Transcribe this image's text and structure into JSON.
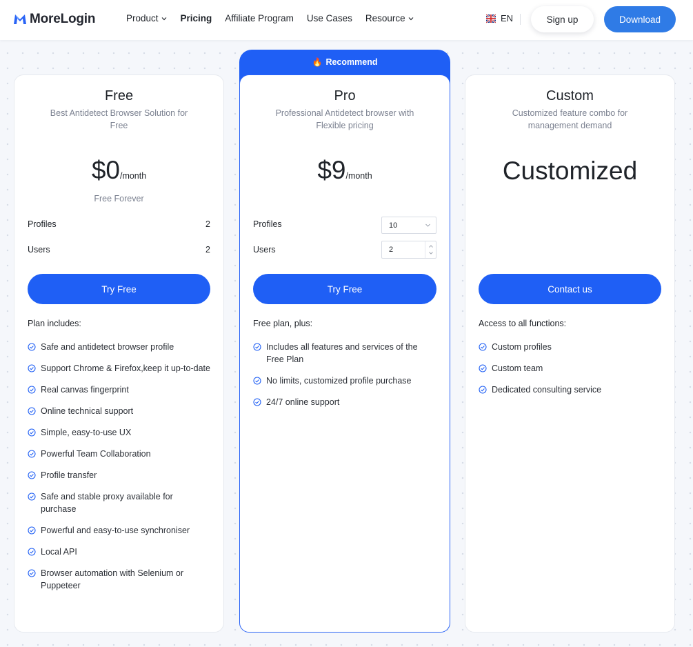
{
  "header": {
    "logo_text": "MoreLogin",
    "nav": [
      {
        "label": "Product",
        "has_dropdown": true,
        "active": false
      },
      {
        "label": "Pricing",
        "has_dropdown": false,
        "active": true
      },
      {
        "label": "Affiliate Program",
        "has_dropdown": false,
        "active": false
      },
      {
        "label": "Use Cases",
        "has_dropdown": false,
        "active": false
      },
      {
        "label": "Resource",
        "has_dropdown": true,
        "active": false
      }
    ],
    "language": "EN",
    "signup_label": "Sign up",
    "download_label": "Download"
  },
  "recommend_badge": "Recommend",
  "plans": {
    "free": {
      "name": "Free",
      "description": "Best Antidetect Browser Solution for Free",
      "price_amount": "$0",
      "price_period": "/month",
      "subnote": "Free Forever",
      "profiles_label": "Profiles",
      "profiles_value": "2",
      "users_label": "Users",
      "users_value": "2",
      "cta_label": "Try Free",
      "includes_title": "Plan includes:",
      "features": [
        "Safe and antidetect browser profile",
        "Support Chrome & Firefox,keep it up-to-date",
        "Real canvas fingerprint",
        "Online technical support",
        "Simple, easy-to-use UX",
        "Powerful Team Collaboration",
        "Profile transfer",
        "Safe and stable proxy available for purchase",
        "Powerful and easy-to-use synchroniser",
        "Local API",
        "Browser automation with Selenium or Puppeteer"
      ]
    },
    "pro": {
      "name": "Pro",
      "description": "Professional Antidetect browser with Flexible pricing",
      "price_amount": "$9",
      "price_period": "/month",
      "profiles_label": "Profiles",
      "profiles_selected": "10",
      "users_label": "Users",
      "users_value": "2",
      "cta_label": "Try Free",
      "includes_title": "Free plan, plus:",
      "features": [
        "Includes all features and services of the Free Plan",
        "No limits, customized profile purchase",
        "24/7 online support"
      ]
    },
    "custom": {
      "name": "Custom",
      "description": "Customized feature combo for management demand",
      "price_text": "Customized",
      "cta_label": "Contact us",
      "includes_title": "Access to all functions:",
      "features": [
        "Custom profiles",
        "Custom team",
        "Dedicated consulting service"
      ]
    }
  },
  "colors": {
    "primary": "#1f5ff5",
    "download_button": "#2f7be6",
    "text": "#1f2329",
    "muted_text": "#7b8190",
    "page_background": "#f5f7fb"
  }
}
